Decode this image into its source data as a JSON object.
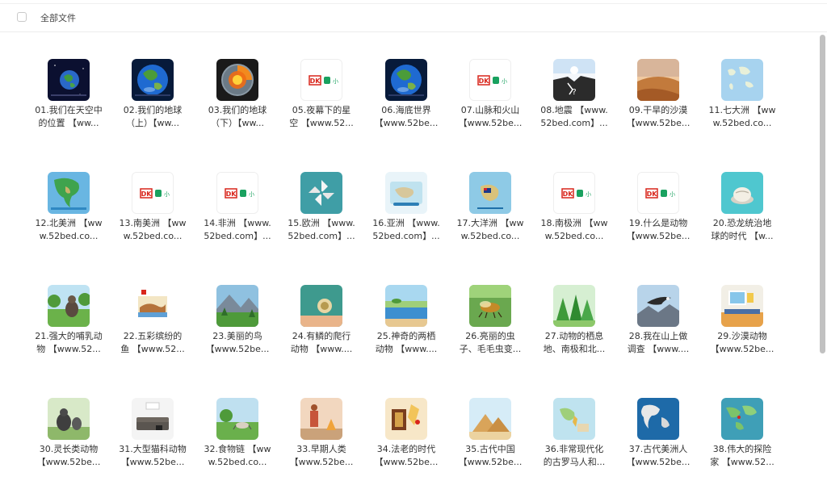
{
  "header": {
    "title": "全部文件"
  },
  "files": [
    {
      "line1": "01.我们在天空中",
      "line2": "的位置 【ww...",
      "thumb": "earth-space"
    },
    {
      "line1": "02.我们的地球",
      "line2": "（上）【ww...",
      "thumb": "earth-blue"
    },
    {
      "line1": "03.我们的地球",
      "line2": "（下）【ww...",
      "thumb": "earth-core"
    },
    {
      "line1": "05.夜幕下的星",
      "line2": "空 【www.52...",
      "thumb": "dk-logo"
    },
    {
      "line1": "06.海底世界",
      "line2": "【www.52be...",
      "thumb": "earth-blue"
    },
    {
      "line1": "07.山脉和火山",
      "line2": "【www.52be...",
      "thumb": "dk-logo"
    },
    {
      "line1": "08.地震 【www.",
      "line2": "52bed.com】...",
      "thumb": "earthquake"
    },
    {
      "line1": "09.干旱的沙漠",
      "line2": "【www.52be...",
      "thumb": "desert"
    },
    {
      "line1": "11.七大洲 【ww",
      "line2": "w.52bed.co...",
      "thumb": "world-map"
    },
    {
      "line1": "12.北美洲 【ww",
      "line2": "w.52bed.co...",
      "thumb": "north-america"
    },
    {
      "line1": "13.南美洲 【ww",
      "line2": "w.52bed.co...",
      "thumb": "dk-logo"
    },
    {
      "line1": "14.非洲 【www.",
      "line2": "52bed.com】...",
      "thumb": "dk-logo"
    },
    {
      "line1": "15.欧洲 【www.",
      "line2": "52bed.com】...",
      "thumb": "pinwheel"
    },
    {
      "line1": "16.亚洲 【www.",
      "line2": "52bed.com】...",
      "thumb": "asia-map"
    },
    {
      "line1": "17.大洋洲 【ww",
      "line2": "w.52bed.co...",
      "thumb": "oceania-map"
    },
    {
      "line1": "18.南极洲 【ww",
      "line2": "w.52bed.co...",
      "thumb": "dk-logo"
    },
    {
      "line1": "19.什么是动物",
      "line2": "【www.52be...",
      "thumb": "dk-logo"
    },
    {
      "line1": "20.恐龙统治地",
      "line2": "球的时代 【w...",
      "thumb": "dino-egg"
    },
    {
      "line1": "21.强大的哺乳动",
      "line2": "物 【www.52...",
      "thumb": "mammal"
    },
    {
      "line1": "22.五彩缤纷的",
      "line2": "鱼 【www.52...",
      "thumb": "fish-book"
    },
    {
      "line1": "23.美丽的鸟",
      "line2": "【www.52be...",
      "thumb": "mountain-bird"
    },
    {
      "line1": "24.有鳞的爬行",
      "line2": "动物 【www....",
      "thumb": "reptile"
    },
    {
      "line1": "25.神奇的两栖",
      "line2": "动物 【www....",
      "thumb": "amphibian"
    },
    {
      "line1": "26.亮丽的虫",
      "line2": "子、毛毛虫变...",
      "thumb": "insect"
    },
    {
      "line1": "27.动物的栖息",
      "line2": "地、南极和北...",
      "thumb": "forest"
    },
    {
      "line1": "28.我在山上做",
      "line2": "调查 【www....",
      "thumb": "eagle"
    },
    {
      "line1": "29.沙漠动物",
      "line2": "【www.52be...",
      "thumb": "room-window"
    },
    {
      "line1": "30.灵长类动物",
      "line2": "【www.52be...",
      "thumb": "primate"
    },
    {
      "line1": "31.大型猫科动物",
      "line2": "【www.52be...",
      "thumb": "sofa"
    },
    {
      "line1": "32.食物链 【ww",
      "line2": "w.52bed.co...",
      "thumb": "food-chain"
    },
    {
      "line1": "33.早期人类",
      "line2": "【www.52be...",
      "thumb": "early-human"
    },
    {
      "line1": "34.法老的时代",
      "line2": "【www.52be...",
      "thumb": "pharaoh"
    },
    {
      "line1": "35.古代中国",
      "line2": "【www.52be...",
      "thumb": "pyramids"
    },
    {
      "line1": "36.非常现代化",
      "line2": "的古罗马人和...",
      "thumb": "rome-map"
    },
    {
      "line1": "37.古代美洲人",
      "line2": "【www.52be...",
      "thumb": "america-map"
    },
    {
      "line1": "38.伟大的探险",
      "line2": "家 【www.52...",
      "thumb": "explorer-map"
    }
  ],
  "colors": {
    "accent": "#19a15f",
    "dk_red": "#d9261c",
    "scrollbar": "#c1c1c1"
  }
}
